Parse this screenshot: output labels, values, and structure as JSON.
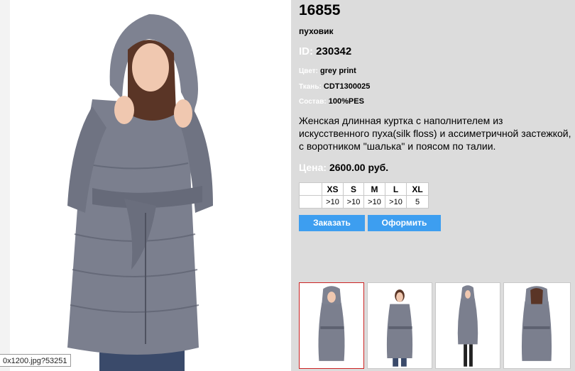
{
  "product": {
    "code": "16855",
    "type": "пуховик",
    "id_label": "ID:",
    "id_value": "230342",
    "color_label": "Цвет:",
    "color_value": "grey print",
    "fabric_label": "Ткань:",
    "fabric_value": "CDT1300025",
    "composition_label": "Состав:",
    "composition_value": "100%PES",
    "description": "Женская длинная  куртка  с наполнителем из искусственного пуха(silk floss) и ассиметричной застежкой, с воротником \"шалька\" и поясом по талии.",
    "price_label": "Цена:",
    "price_value": "2600.00 руб."
  },
  "sizes": {
    "headers": [
      "",
      "XS",
      "S",
      "M",
      "L",
      "XL"
    ],
    "stock": [
      "",
      ">10",
      ">10",
      ">10",
      ">10",
      "5"
    ]
  },
  "buttons": {
    "order": "Заказать",
    "checkout": "Оформить"
  },
  "status": {
    "url_tooltip": "0x1200.jpg?53251"
  },
  "colors": {
    "background": "#dcdcdc",
    "button": "#3d9ef0",
    "active_thumb_border": "#cc2222",
    "coat": "#7b7f8e"
  }
}
